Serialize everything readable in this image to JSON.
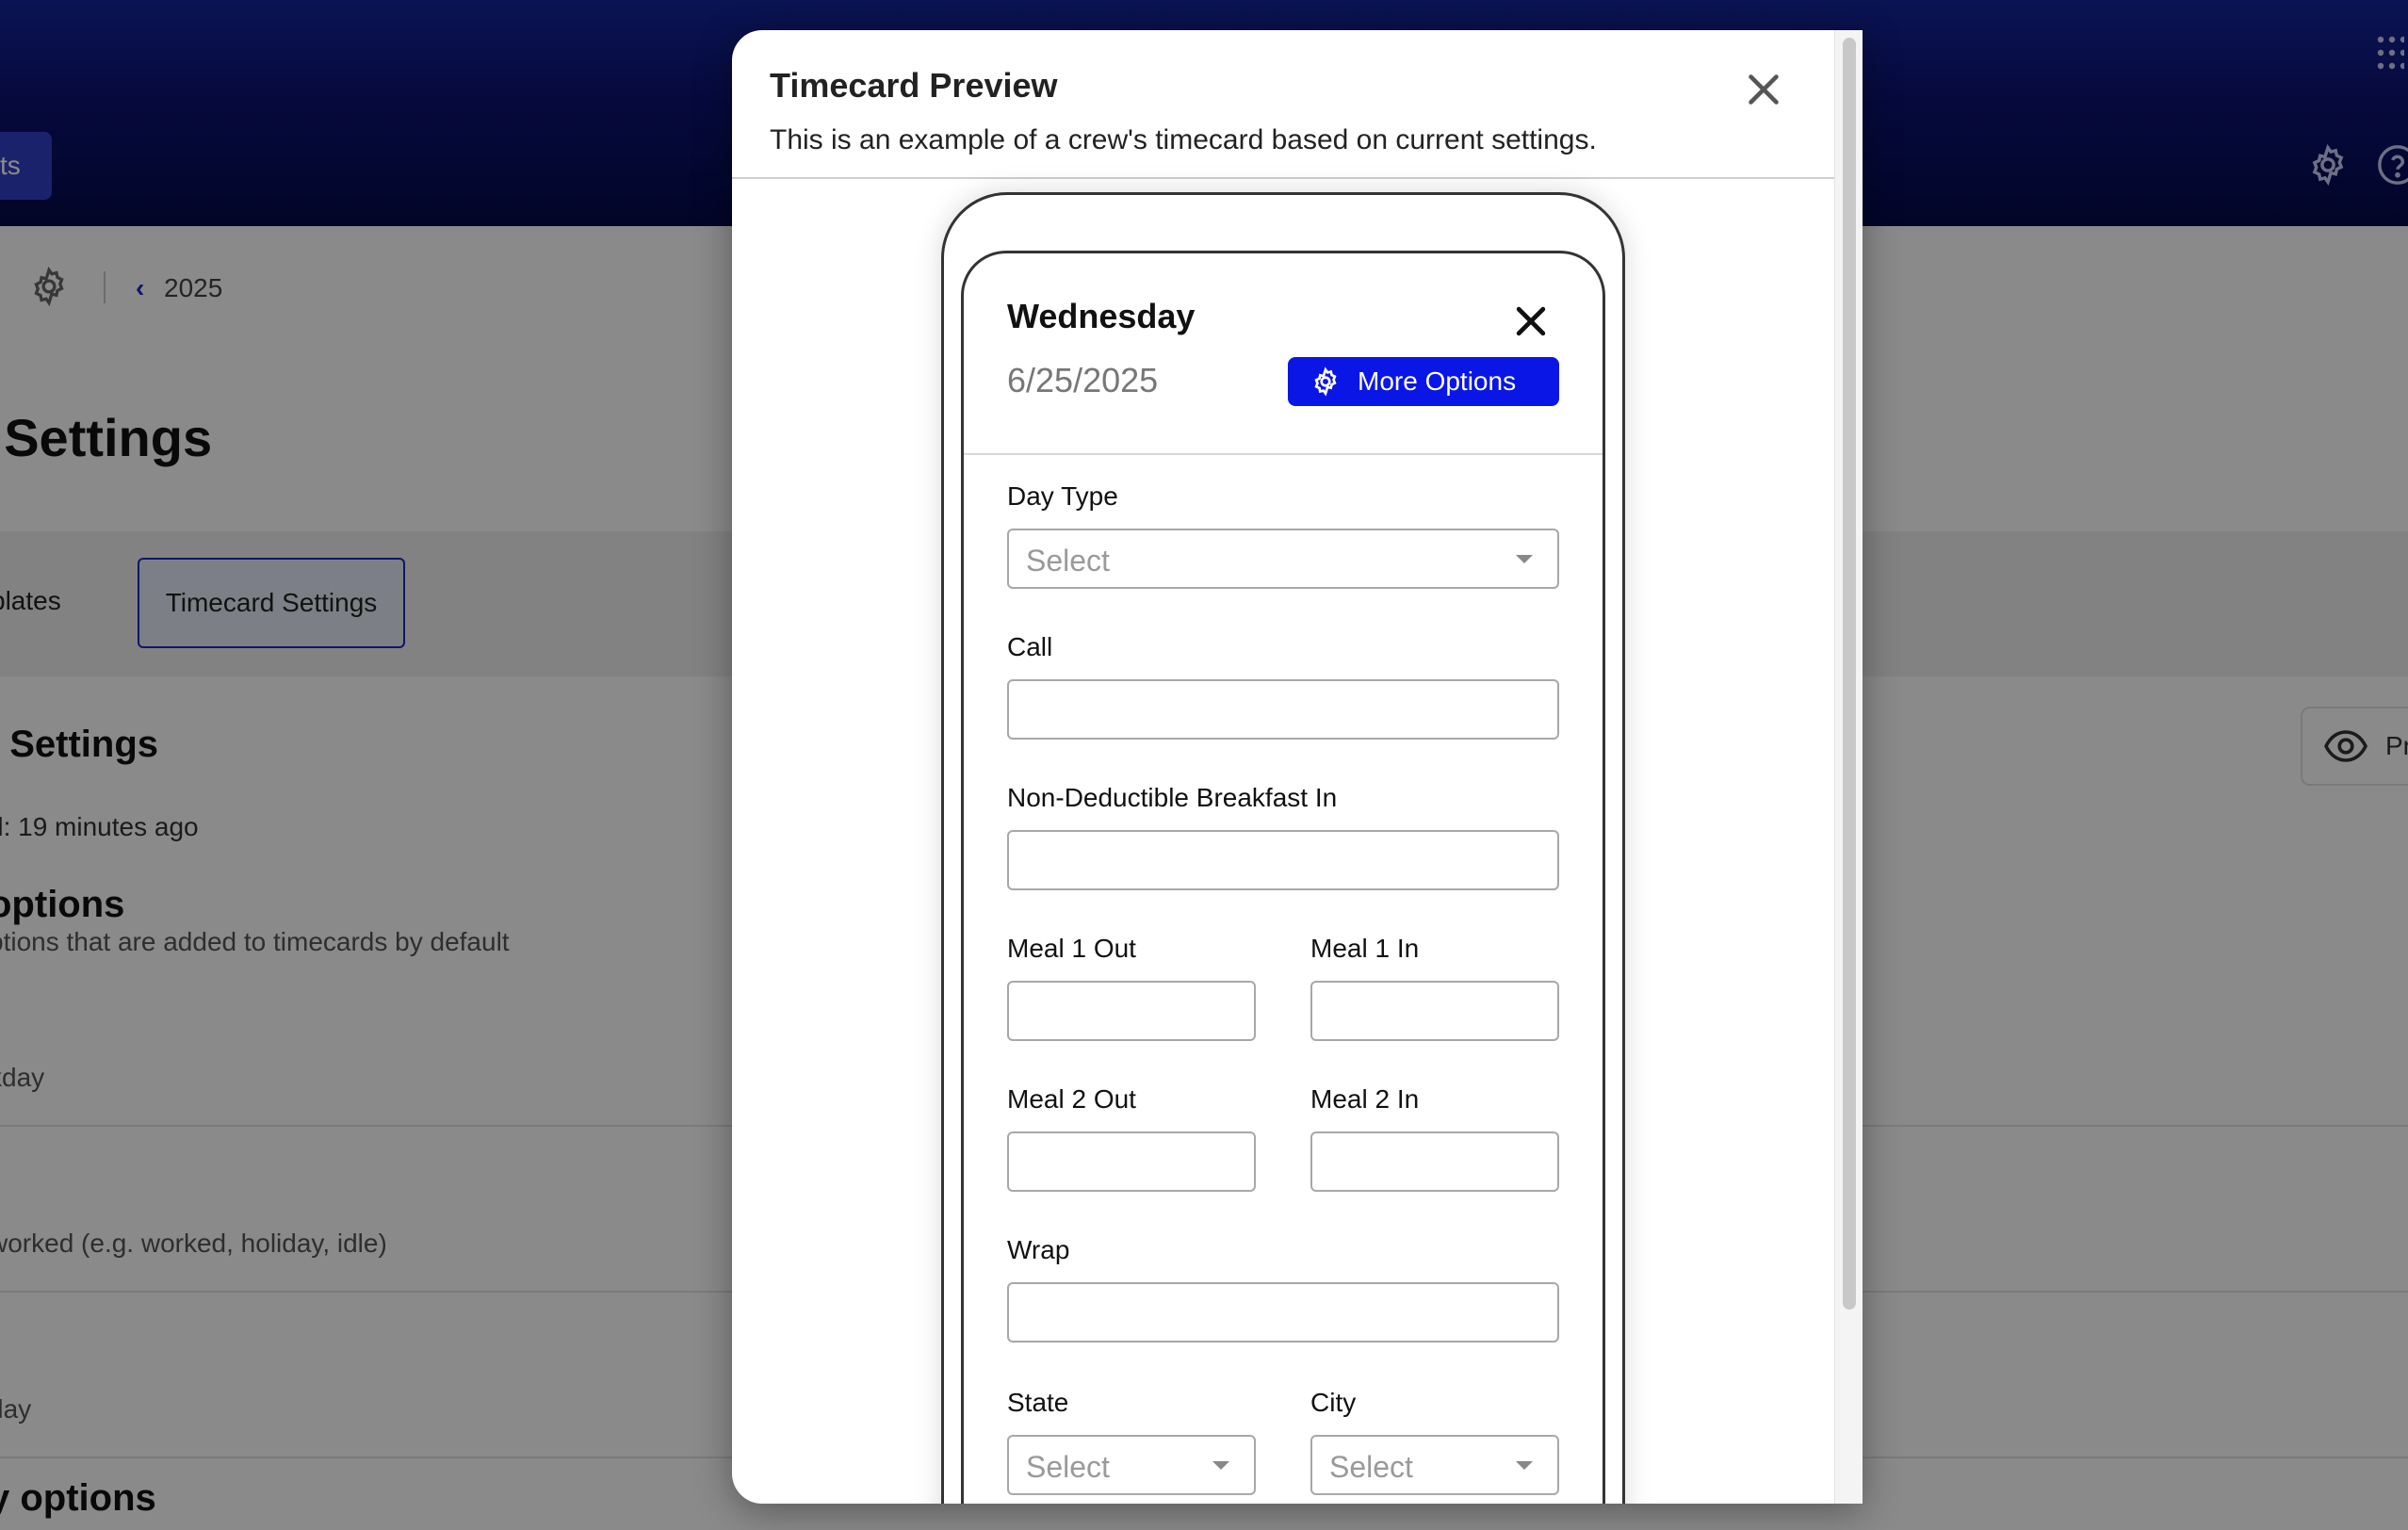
{
  "header": {
    "left_button_label": "ts",
    "icons": [
      "grid-icon",
      "gear-icon",
      "help-icon"
    ]
  },
  "breadcrumb": {
    "year": "2025"
  },
  "page": {
    "title": "t Settings"
  },
  "tabs": [
    {
      "label": "plates"
    },
    {
      "label": "Timecard Settings",
      "active": true
    }
  ],
  "section": {
    "title": "l Settings",
    "saved": "d: 19 minutes ago",
    "options_title": "options",
    "options_desc": "ptions that are added to timecards by default",
    "rows": [
      "kday",
      "worked (e.g. worked, holiday, idle)",
      "day"
    ],
    "options2_title": "y options"
  },
  "preview_button": {
    "label": "Pr"
  },
  "modal": {
    "title": "Timecard Preview",
    "subtitle": "This is an example of a crew's timecard based on current settings.",
    "card": {
      "day": "Wednesday",
      "date": "6/25/2025",
      "more_options": "More Options",
      "fields": {
        "day_type": {
          "label": "Day Type",
          "placeholder": "Select"
        },
        "call": {
          "label": "Call",
          "value": ""
        },
        "ndb_in": {
          "label": "Non-Deductible Breakfast In",
          "value": ""
        },
        "meal1_out": {
          "label": "Meal 1 Out",
          "value": ""
        },
        "meal1_in": {
          "label": "Meal 1 In",
          "value": ""
        },
        "meal2_out": {
          "label": "Meal 2 Out",
          "value": ""
        },
        "meal2_in": {
          "label": "Meal 2 In",
          "value": ""
        },
        "wrap": {
          "label": "Wrap",
          "value": ""
        },
        "state": {
          "label": "State",
          "placeholder": "Select"
        },
        "city": {
          "label": "City",
          "placeholder": "Select"
        }
      }
    }
  },
  "colors": {
    "header_dark": "#050a4a",
    "header_light": "#15259b",
    "accent_button": "#0a16e6",
    "active_tab_border": "#1a2ac0"
  }
}
